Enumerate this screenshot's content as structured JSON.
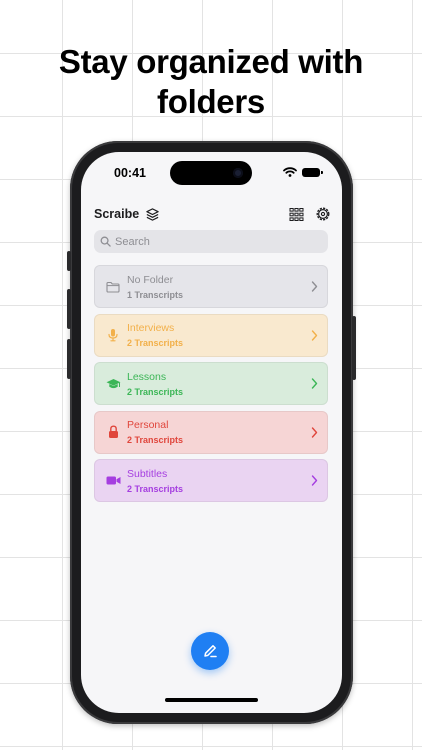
{
  "headline": {
    "line1": "Stay organized with",
    "line2": "folders"
  },
  "status_bar": {
    "time": "00:41"
  },
  "app": {
    "title": "Scraibe",
    "icons": [
      "layers-icon",
      "grid-icon",
      "settings-icon"
    ]
  },
  "search": {
    "placeholder": "Search",
    "value": ""
  },
  "folders": [
    {
      "name": "No Folder",
      "count": "1 Transcripts",
      "icon": "folder-icon",
      "color": "#8e8e93",
      "bg": "#e5e5ea"
    },
    {
      "name": "Interviews",
      "count": "2 Transcripts",
      "icon": "microphone-icon",
      "color": "#f2b04a",
      "bg": "#f9e9cf"
    },
    {
      "name": "Lessons",
      "count": "2 Transcripts",
      "icon": "graduation-cap-icon",
      "color": "#3cb657",
      "bg": "#d9ecdc"
    },
    {
      "name": "Personal",
      "count": "2 Transcripts",
      "icon": "lock-icon",
      "color": "#e0463c",
      "bg": "#f6d5d5"
    },
    {
      "name": "Subtitles",
      "count": "2 Transcripts",
      "icon": "video-camera-icon",
      "color": "#a53ee0",
      "bg": "#ead4f2"
    }
  ],
  "fab": {
    "icon": "compose-icon",
    "color": "#1f7ff3"
  }
}
